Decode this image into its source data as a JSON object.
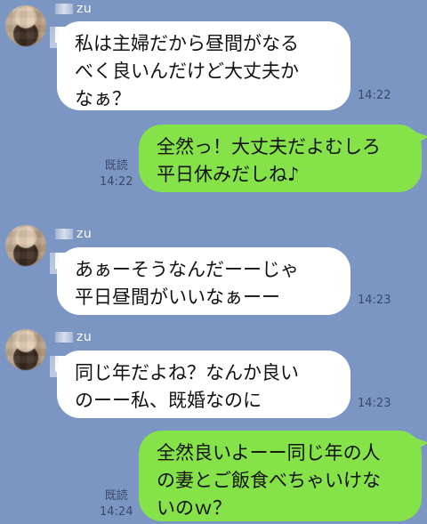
{
  "messages": [
    {
      "sender": "zu",
      "text": "私は主婦だから昼間がなる\nべく良いんだけど大丈夫か\nなぁ？",
      "time": "14:22"
    },
    {
      "sender": "self",
      "text": "全然っ！大丈夫だよむしろ\n平日休みだしね♪",
      "read": "既読",
      "time": "14:22"
    },
    {
      "sender": "zu",
      "text": "あぁーそうなんだーーじゃ\n平日昼間がいいなぁーー",
      "time": "14:23"
    },
    {
      "sender": "zu",
      "text": "同じ年だよね？なんか良い\nのーー私、既婚なのに",
      "time": "14:23"
    },
    {
      "sender": "self",
      "text": "全然良いよーー同じ年の人\nの妻とご飯食べちゃいけな\nいのｗ？",
      "read": "既読",
      "time": "14:24"
    }
  ],
  "colors": {
    "background": "#7b96c3",
    "incoming": "#ffffff",
    "outgoing": "#85e249"
  }
}
